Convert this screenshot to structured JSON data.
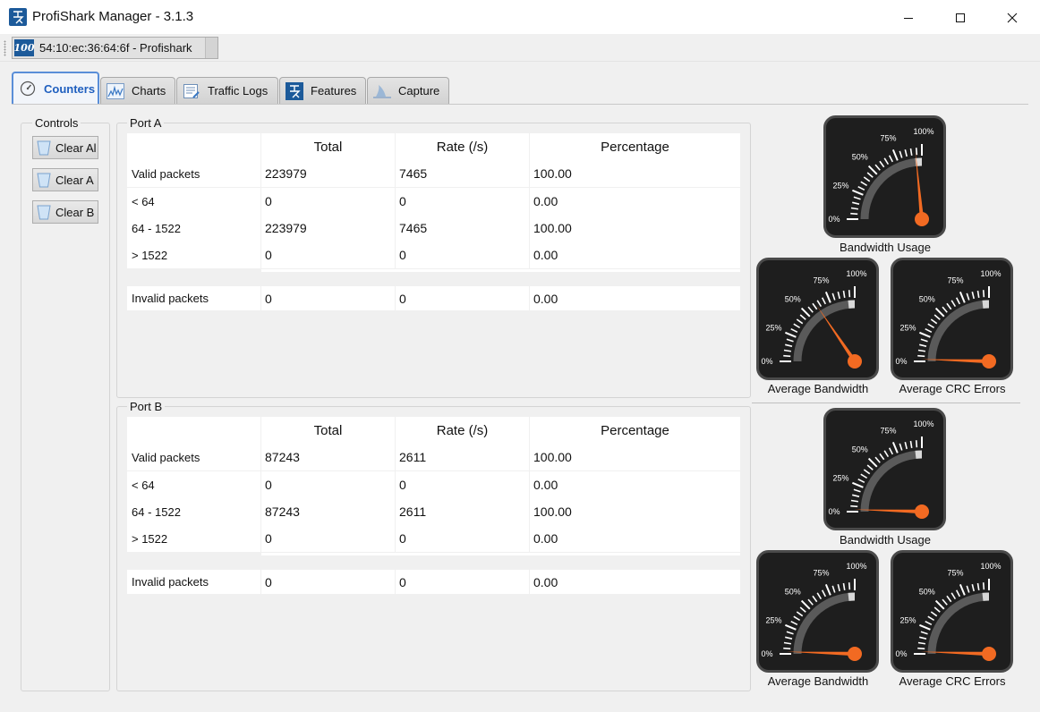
{
  "window": {
    "title": "ProfiShark Manager - 3.1.3"
  },
  "device": {
    "badge": "100",
    "label": "54:10:ec:36:64:6f - Profishark"
  },
  "tabs": [
    {
      "label": "Counters",
      "icon": "gauge-icon",
      "active": true
    },
    {
      "label": "Charts",
      "icon": "chart-icon",
      "active": false
    },
    {
      "label": "Traffic Logs",
      "icon": "log-icon",
      "active": false
    },
    {
      "label": "Features",
      "icon": "profishark-logo-icon",
      "active": false
    },
    {
      "label": "Capture",
      "icon": "shark-fin-icon",
      "active": false
    }
  ],
  "controls": {
    "title": "Controls",
    "buttons": [
      {
        "label": "Clear Al"
      },
      {
        "label": "Clear A"
      },
      {
        "label": "Clear B"
      }
    ]
  },
  "headers": {
    "total": "Total",
    "rate": "Rate (/s)",
    "percentage": "Percentage"
  },
  "ports": [
    {
      "title": "Port A",
      "rows": [
        {
          "label": "Valid packets",
          "total": "223979",
          "rate": "7465",
          "percentage": "100.00"
        },
        {
          "label": "< 64",
          "total": "0",
          "rate": "0",
          "percentage": "0.00"
        },
        {
          "label": "64 - 1522",
          "total": "223979",
          "rate": "7465",
          "percentage": "100.00"
        },
        {
          "label": "> 1522",
          "total": "0",
          "rate": "0",
          "percentage": "0.00"
        }
      ],
      "invalid": {
        "label": "Invalid packets",
        "total": "0",
        "rate": "0",
        "percentage": "0.00"
      },
      "gauges": [
        {
          "caption": "Bandwidth Usage",
          "value_percent": 94
        },
        {
          "caption": "Average Bandwidth",
          "value_percent": 62
        },
        {
          "caption": "Average CRC Errors",
          "value_percent": 2
        }
      ]
    },
    {
      "title": "Port B",
      "rows": [
        {
          "label": "Valid packets",
          "total": "87243",
          "rate": "2611",
          "percentage": "100.00"
        },
        {
          "label": "< 64",
          "total": "0",
          "rate": "0",
          "percentage": "0.00"
        },
        {
          "label": "64 - 1522",
          "total": "87243",
          "rate": "2611",
          "percentage": "100.00"
        },
        {
          "label": "> 1522",
          "total": "0",
          "rate": "0",
          "percentage": "0.00"
        }
      ],
      "invalid": {
        "label": "Invalid packets",
        "total": "0",
        "rate": "0",
        "percentage": "0.00"
      },
      "gauges": [
        {
          "caption": "Bandwidth Usage",
          "value_percent": 2
        },
        {
          "caption": "Average Bandwidth",
          "value_percent": 2
        },
        {
          "caption": "Average CRC Errors",
          "value_percent": 2
        }
      ]
    }
  ],
  "gauge_scale": [
    "0%",
    "25%",
    "50%",
    "75%",
    "100%"
  ],
  "colors": {
    "accent": "#1f5fbf",
    "needle": "#f26a22",
    "gauge_face": "#1e1e1e",
    "gauge_band": "#5a5a5a"
  }
}
